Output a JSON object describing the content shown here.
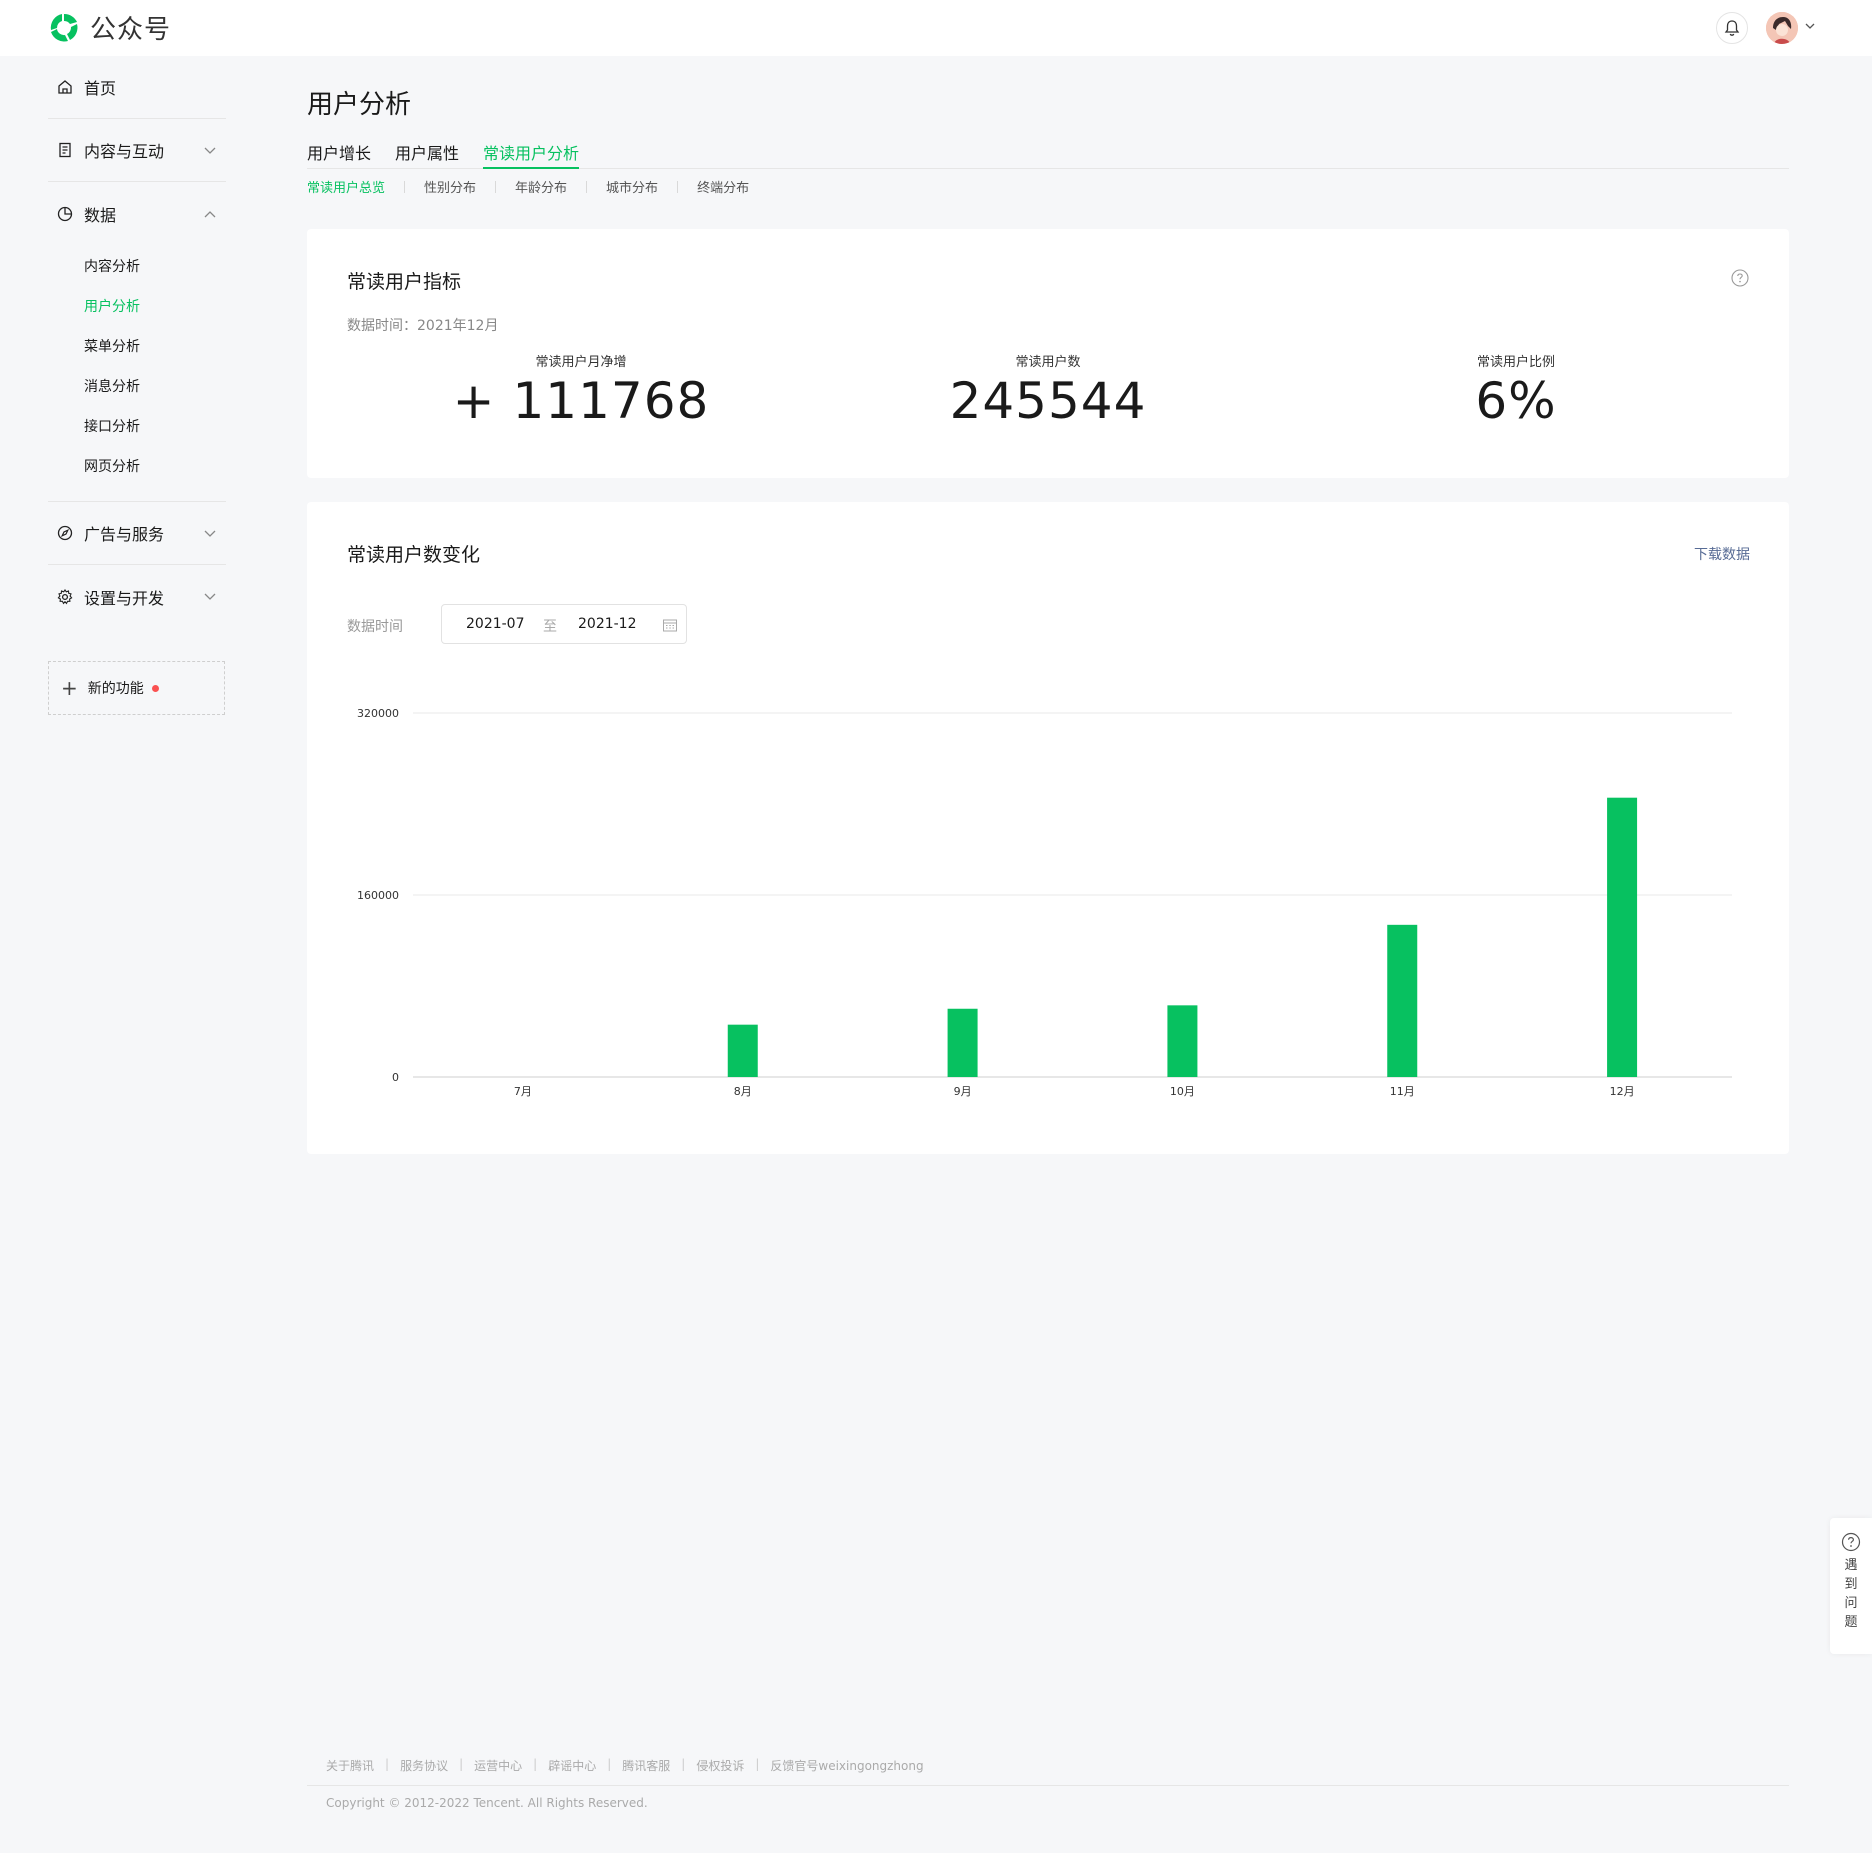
{
  "topbar": {
    "app_name": "公众号"
  },
  "sidebar": {
    "home": "首页",
    "content": "内容与互动",
    "data": "数据",
    "data_items": [
      "内容分析",
      "用户分析",
      "菜单分析",
      "消息分析",
      "接口分析",
      "网页分析"
    ],
    "ads": "广告与服务",
    "settings": "设置与开发",
    "new_feature": "新的功能"
  },
  "main": {
    "page_title": "用户分析",
    "tabs": [
      "用户增长",
      "用户属性",
      "常读用户分析"
    ],
    "subtabs": [
      "常读用户总览",
      "性别分布",
      "年龄分布",
      "城市分布",
      "终端分布"
    ]
  },
  "metrics_card": {
    "title": "常读用户指标",
    "data_time": "数据时间：2021年12月",
    "metrics": [
      {
        "label": "常读用户月净增",
        "value": "+ 111768"
      },
      {
        "label": "常读用户数",
        "value": "245544"
      },
      {
        "label": "常读用户比例",
        "value": "6%"
      }
    ]
  },
  "trend_card": {
    "title": "常读用户数变化",
    "download": "下载数据",
    "range_label": "数据时间",
    "start": "2021-07",
    "to": "至",
    "end": "2021-12"
  },
  "chart_data": {
    "type": "bar",
    "categories": [
      "7月",
      "8月",
      "9月",
      "10月",
      "11月",
      "12月"
    ],
    "values": [
      0,
      46000,
      60000,
      63000,
      133776,
      245544
    ],
    "ylim": [
      0,
      320000
    ],
    "yticks": [
      0,
      160000,
      320000
    ],
    "grid": true,
    "bar_color": "#07c160"
  },
  "footer": {
    "links": [
      "关于腾讯",
      "服务协议",
      "运营中心",
      "辟谣中心",
      "腾讯客服",
      "侵权投诉",
      "反馈官号weixingongzhong"
    ],
    "copyright": "Copyright © 2012-2022 Tencent. All Rights Reserved."
  },
  "float_help": {
    "label": "遇到问题"
  },
  "colors": {
    "accent": "#07c160",
    "link": "#576b95",
    "notice": "#fa5151"
  }
}
